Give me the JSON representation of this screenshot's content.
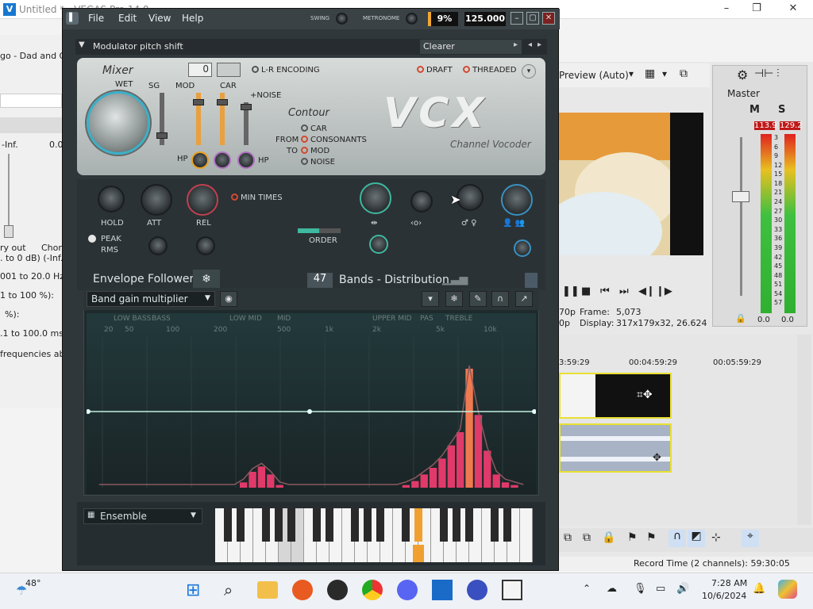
{
  "vegas": {
    "title": "Untitled * - VEGAS Pro 14.0",
    "left_pane": {
      "item1": "go - Dad and G",
      "inf": "-Inf.",
      "zero": "0.0",
      "ry_out": "ry out",
      "chor": "Chor",
      "line1": ". to 0 dB) (-Inf. t",
      "line2": "001 to 20.0 Hz):",
      "line3": "1 to 100 %):",
      "line4": "%):",
      "line5": ".1 to 100.0 ms)",
      "line6": "frequencies abo"
    },
    "preview_label": "Preview (Auto)",
    "master_label": "Master",
    "meter_left_peak": "113.9",
    "meter_right_peak": "129.2",
    "meter_scale": [
      "3",
      "6",
      "9",
      "12",
      "15",
      "18",
      "21",
      "24",
      "27",
      "30",
      "33",
      "36",
      "39",
      "42",
      "45",
      "48",
      "51",
      "54",
      "57"
    ],
    "meter_bottom_left": "0.0",
    "meter_bottom_right": "0.0",
    "frame_label": "Frame:",
    "frame_value": "5,073",
    "display_label": "Display:",
    "display_value": "317x179x32, 26.624",
    "res_a": "70p",
    "res_b": "0p",
    "timecodes": [
      "3:59:29",
      "00:04:59:29",
      "00:05:59:29"
    ],
    "record_time": "Record Time (2 channels): 59:30:05"
  },
  "fl": {
    "menu": [
      "File",
      "Edit",
      "View",
      "Help"
    ],
    "swing_label": "SWING",
    "metronome_label": "METRONOME",
    "cpu": "9%",
    "tempo": "125.000",
    "plugin_title": "Modulator pitch shift",
    "preset": "Clearer",
    "mixer_label": "Mixer",
    "wet_label": "WET",
    "sg_label": "SG",
    "mod_label": "MOD",
    "car_label": "CAR",
    "noise_plus": "+NOISE",
    "value_box": "0",
    "lr_encoding": "L-R ENCODING",
    "draft": "DRAFT",
    "threaded": "THREADED",
    "contour_label": "Contour",
    "contour_car": "CAR",
    "contour_from": "FROM",
    "contour_to": "TO",
    "contour_consonants": "CONSONANTS",
    "contour_mod": "MOD",
    "contour_noise": "NOISE",
    "vcx_logo": "VCX",
    "channel_vocoder": "Channel Vocoder",
    "hp_left": "HP",
    "hp_right": "HP",
    "hold": "HOLD",
    "att": "ATT",
    "rel": "REL",
    "min_times": "MIN TIMES",
    "peak": "PEAK",
    "rms": "RMS",
    "order": "ORDER",
    "envelope_follower": "Envelope Follower",
    "bands_count": "47",
    "bands_label": "Bands - Distribution",
    "band_gain_dropdown": "Band gain multiplier",
    "freq_zones": [
      "LOW BASS",
      "BASS",
      "LOW MID",
      "MID",
      "UPPER MID",
      "PAS",
      "TREBLE"
    ],
    "freq_ticks": [
      "20",
      "50",
      "100",
      "200",
      "500",
      "1k",
      "2k",
      "5k",
      "10k"
    ],
    "ensemble": "Ensemble",
    "band_bars": [
      0.0,
      0.0,
      0.0,
      0.0,
      0.0,
      0.0,
      0.0,
      0.0,
      0.0,
      0.0,
      0.0,
      0.0,
      0.0,
      0.0,
      0.0,
      0.0,
      0.04,
      0.12,
      0.16,
      0.1,
      0.02,
      0.0,
      0.0,
      0.0,
      0.0,
      0.0,
      0.0,
      0.0,
      0.0,
      0.0,
      0.0,
      0.0,
      0.0,
      0.0,
      0.02,
      0.05,
      0.1,
      0.15,
      0.22,
      0.32,
      0.42,
      0.9,
      0.55,
      0.28,
      0.1,
      0.04,
      0.02,
      0.0
    ]
  },
  "taskbar": {
    "weather": "48°",
    "time": "7:28 AM",
    "date": "10/6/2024"
  },
  "colors": {
    "accent": "#e8503a",
    "teal": "#3fb8a0",
    "plugin_bg": "#30373b"
  }
}
